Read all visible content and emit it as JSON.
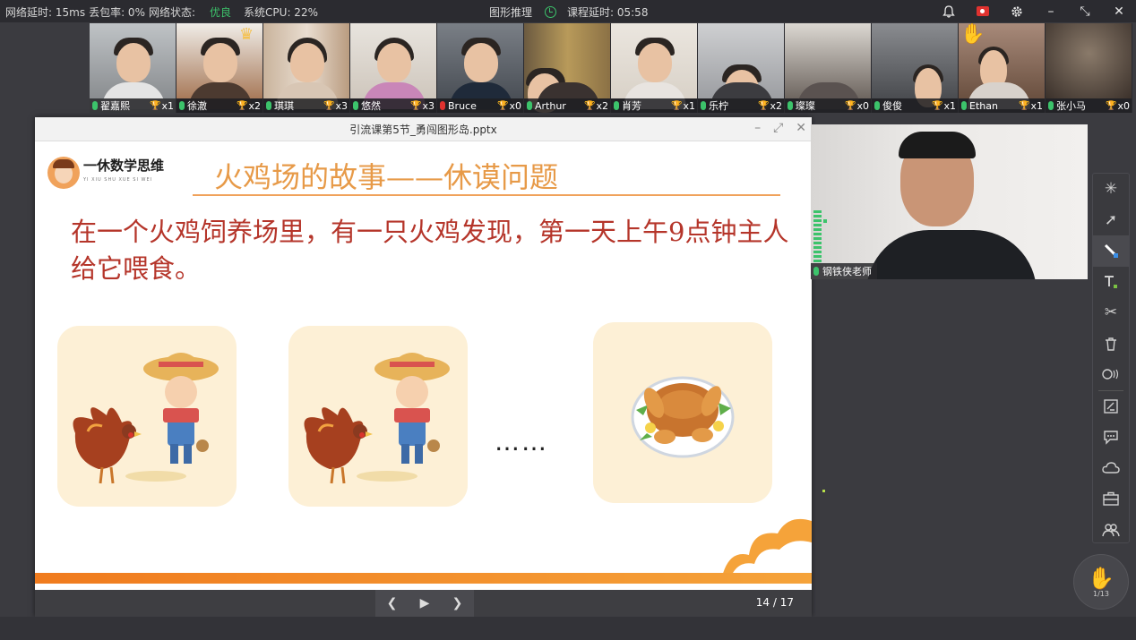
{
  "topbar": {
    "network_delay": "网络延时: 15ms",
    "packet_loss": "丢包率: 0%",
    "network_status_label": "网络状态:",
    "network_status_value": "优良",
    "cpu": "系统CPU: 22%",
    "graphic_reasoning": "图形推理",
    "course_delay": "课程延时: 05:58"
  },
  "students": [
    {
      "name": "翟嘉熙",
      "trophy": "x1",
      "mic": "on"
    },
    {
      "name": "徐澈",
      "trophy": "x2",
      "mic": "on"
    },
    {
      "name": "琪琪",
      "trophy": "x3",
      "mic": "on"
    },
    {
      "name": "悠然",
      "trophy": "x3",
      "mic": "on"
    },
    {
      "name": "Bruce",
      "trophy": "x0",
      "mic": "off"
    },
    {
      "name": "Arthur",
      "trophy": "x2",
      "mic": "on"
    },
    {
      "name": "肖芳",
      "trophy": "x1",
      "mic": "on"
    },
    {
      "name": "乐柠",
      "trophy": "x2",
      "mic": "on"
    },
    {
      "name": "璨璨",
      "trophy": "x0",
      "mic": "on"
    },
    {
      "name": "俊俊",
      "trophy": "x1",
      "mic": "on"
    },
    {
      "name": "Ethan",
      "trophy": "x1",
      "mic": "on"
    },
    {
      "name": "张小马",
      "trophy": "x0",
      "mic": "on"
    }
  ],
  "slide_window": {
    "filename": "引流课第5节_勇闯图形岛.pptx",
    "page": "14 / 17"
  },
  "slide": {
    "brand": "一休数学思维",
    "brand_sub": "YI XIU SHU XUE SI WEI",
    "title": "火鸡场的故事——休谟问题",
    "body": "在一个火鸡饲养场里，有一只火鸡发现，第一天上午9点钟主人给它喂食。",
    "ellipsis": "……"
  },
  "teacher": {
    "name": "钢铁侠老师"
  },
  "hand_raise": {
    "count": "1/13"
  },
  "colors": {
    "accent_orange": "#f0a25b",
    "body_red": "#b5352a",
    "status_green": "#3cc36b"
  }
}
